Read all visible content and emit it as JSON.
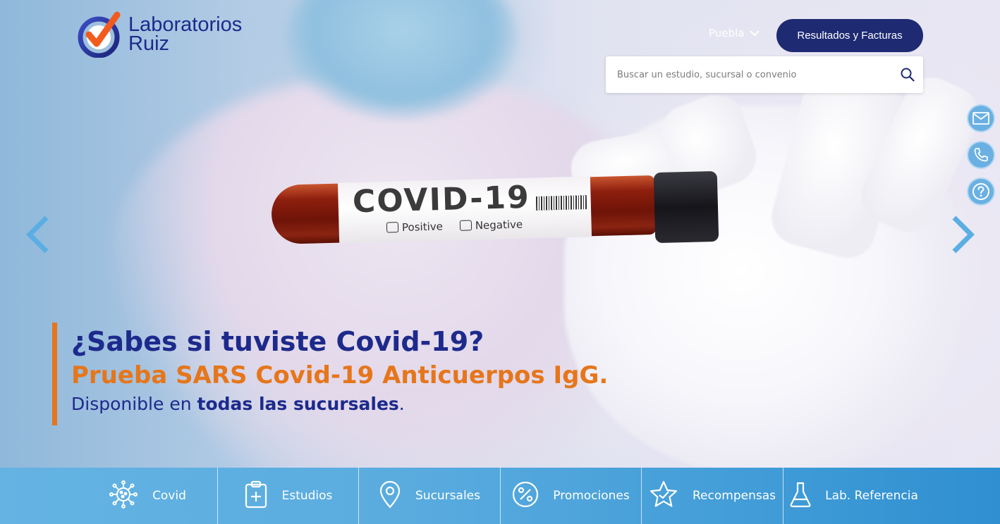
{
  "brand": {
    "line1": "Laboratorios",
    "line2": "Ruiz",
    "primary_color": "#1d2a8c",
    "accent_color": "#e6761b"
  },
  "header": {
    "region": "Puebla",
    "results_button": "Resultados y Facturas",
    "search_placeholder": "Buscar un estudio, sucursal o convenio"
  },
  "hero": {
    "tube_title": "COVID-19",
    "tube_positive": "Positive",
    "tube_negative": "Negative",
    "title": "¿Sabes si tuviste Covid-19?",
    "subtitle": "Prueba SARS Covid-19 Anticuerpos IgG.",
    "line_prefix": "Disponible en ",
    "line_bold": "todas las sucursales",
    "line_suffix": "."
  },
  "side_buttons": [
    "mail-icon",
    "phone-icon",
    "help-icon"
  ],
  "nav": {
    "items": [
      {
        "label": "Covid",
        "icon": "virus-icon"
      },
      {
        "label": "Estudios",
        "icon": "clipboard-plus-icon"
      },
      {
        "label": "Sucursales",
        "icon": "location-pin-icon"
      },
      {
        "label": "Promociones",
        "icon": "percent-icon"
      },
      {
        "label": "Recompensas",
        "icon": "star-icon"
      },
      {
        "label": "Lab. Referencia",
        "icon": "flask-icon"
      }
    ]
  }
}
